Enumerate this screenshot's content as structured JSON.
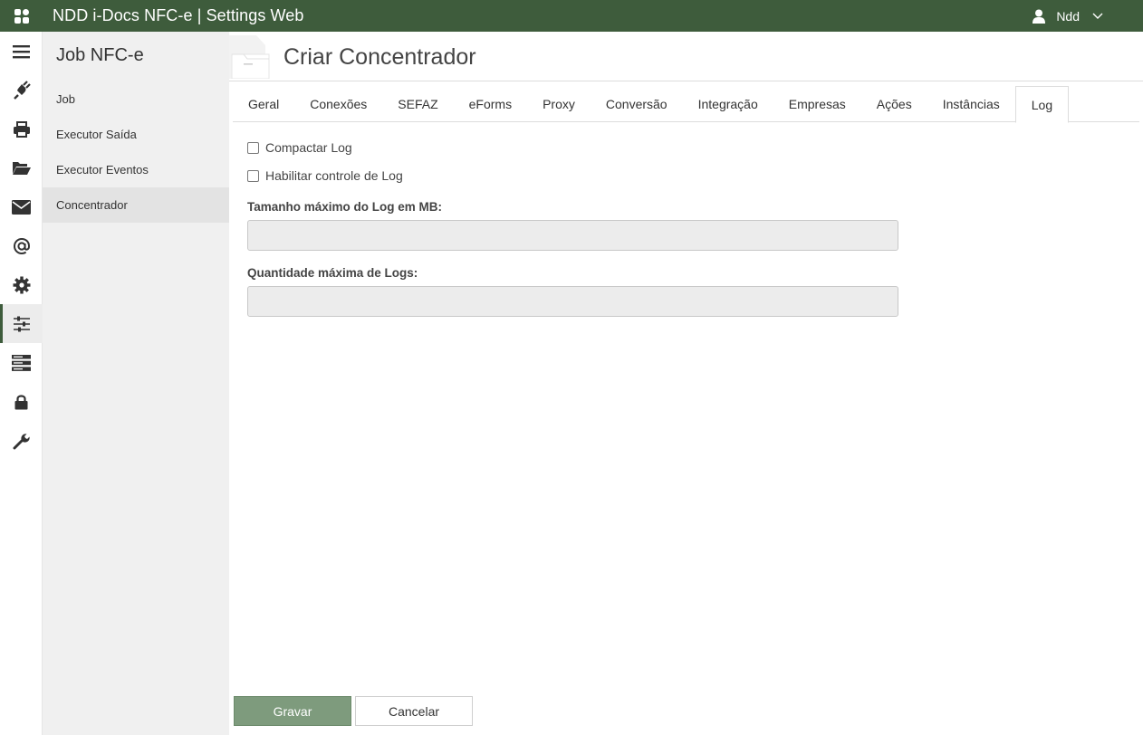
{
  "app": {
    "title": "NDD i-Docs NFC-e | Settings Web",
    "user": "Ndd"
  },
  "rail": {
    "icons": [
      "menu-icon",
      "plug-icon",
      "printer-icon",
      "folder-open-icon",
      "envelope-icon",
      "at-icon",
      "gear-icon",
      "sliders-icon",
      "server-icon",
      "lock-icon",
      "wrench-icon"
    ],
    "active": "sliders-icon"
  },
  "sidebar": {
    "title": "Job NFC-e",
    "items": [
      {
        "label": "Job"
      },
      {
        "label": "Executor Saída"
      },
      {
        "label": "Executor Eventos"
      },
      {
        "label": "Concentrador"
      }
    ],
    "active": "Concentrador"
  },
  "page": {
    "title": "Criar Concentrador"
  },
  "tabs": [
    {
      "label": "Geral"
    },
    {
      "label": "Conexões"
    },
    {
      "label": "SEFAZ"
    },
    {
      "label": "eForms"
    },
    {
      "label": "Proxy"
    },
    {
      "label": "Conversão"
    },
    {
      "label": "Integração"
    },
    {
      "label": "Empresas"
    },
    {
      "label": "Ações"
    },
    {
      "label": "Instâncias"
    },
    {
      "label": "Log"
    }
  ],
  "active_tab": "Log",
  "form": {
    "compactar_log": {
      "label": "Compactar Log",
      "checked": false
    },
    "habilitar_controle": {
      "label": "Habilitar controle de Log",
      "checked": false
    },
    "tamanho_maximo": {
      "label": "Tamanho máximo do Log em MB:",
      "value": ""
    },
    "quantidade_maxima": {
      "label": "Quantidade máxima de Logs:",
      "value": ""
    }
  },
  "buttons": {
    "save": "Gravar",
    "cancel": "Cancelar"
  },
  "colors": {
    "topbar": "#3e5c3c",
    "primary_button": "#7e9b7d"
  }
}
